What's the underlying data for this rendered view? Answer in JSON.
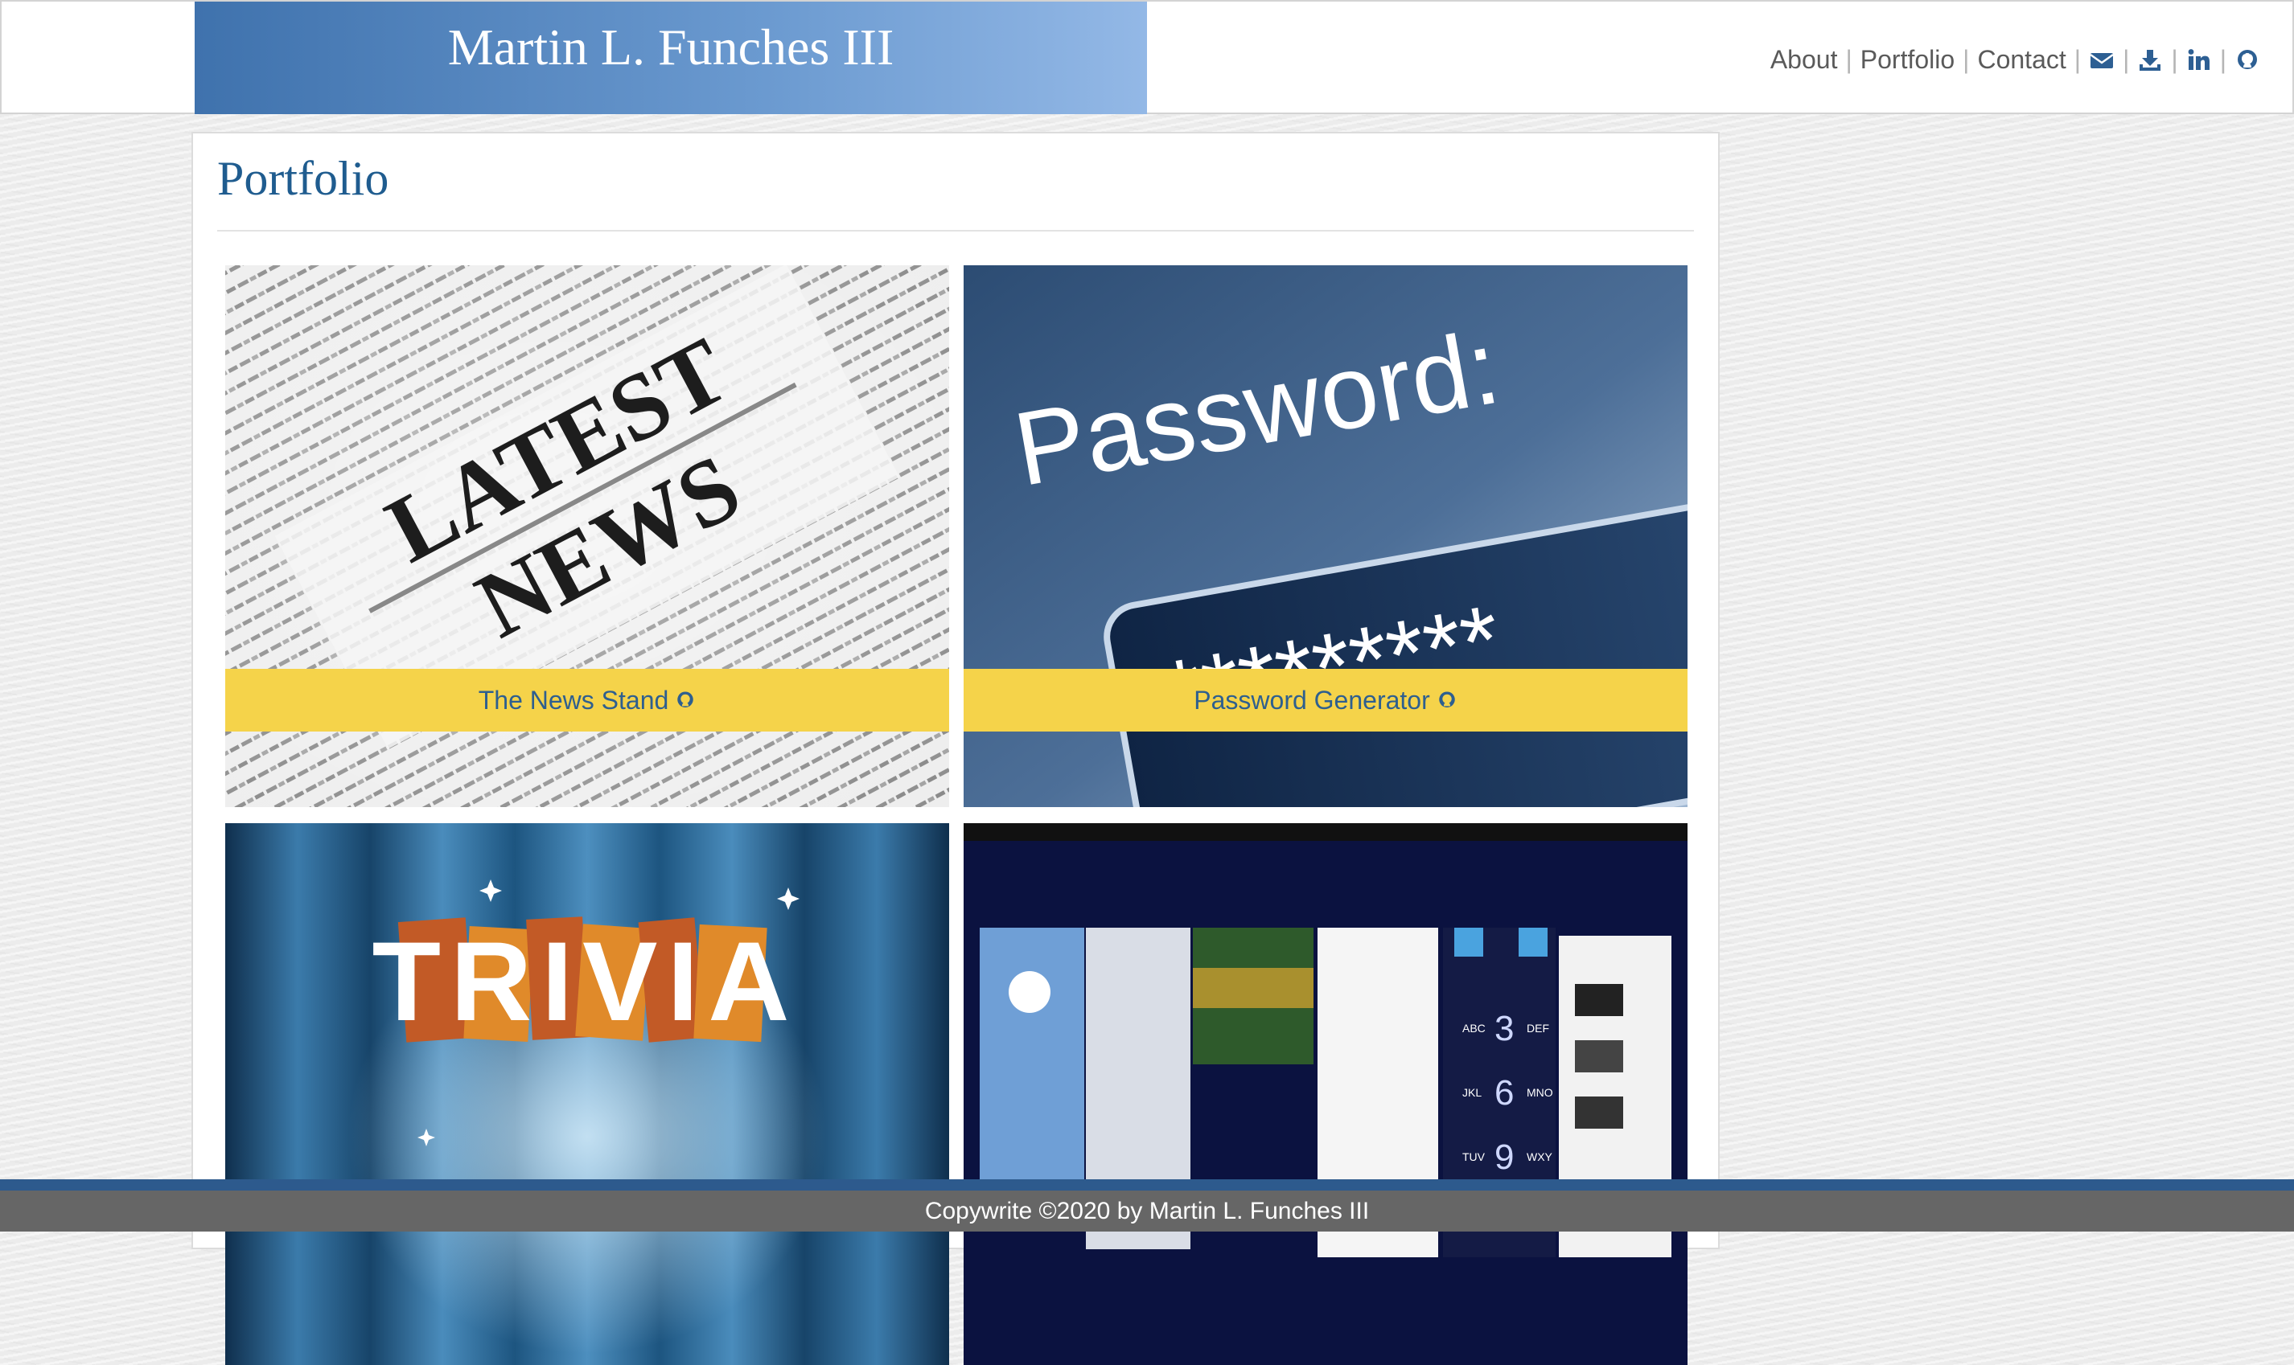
{
  "header": {
    "title": "Martin L. Funches III",
    "nav": {
      "about": "About",
      "portfolio": "Portfolio",
      "contact": "Contact",
      "separator": "|"
    },
    "icons": [
      "envelope-icon",
      "download-icon",
      "linkedin-icon",
      "github-icon"
    ]
  },
  "main": {
    "heading": "Portfolio",
    "projects": [
      {
        "caption": "The News Stand",
        "image_text": [
          "LATEST",
          "NEWS"
        ],
        "icon": "github-icon"
      },
      {
        "caption": "Password Generator",
        "image_text": [
          "Password:",
          "*********"
        ],
        "icon": "github-icon"
      },
      {
        "caption": "",
        "image_text": [
          "TRIVIA"
        ],
        "icon": "github-icon"
      },
      {
        "caption": "",
        "image_text": [
          "ABC",
          "DEF",
          "3",
          "JKL",
          "6",
          "MNO",
          "TUV",
          "9",
          "WXY"
        ],
        "icon": "github-icon"
      }
    ]
  },
  "footer": {
    "text": "Copywrite ©2020 by Martin L. Funches III"
  },
  "colors": {
    "brand_gradient_start": "#3f72ad",
    "brand_gradient_end": "#93b8e6",
    "heading": "#1f5c8f",
    "caption_bg": "#f5d34a",
    "footer_bg": "#666666",
    "footer_accent": "#2d5a8d"
  }
}
